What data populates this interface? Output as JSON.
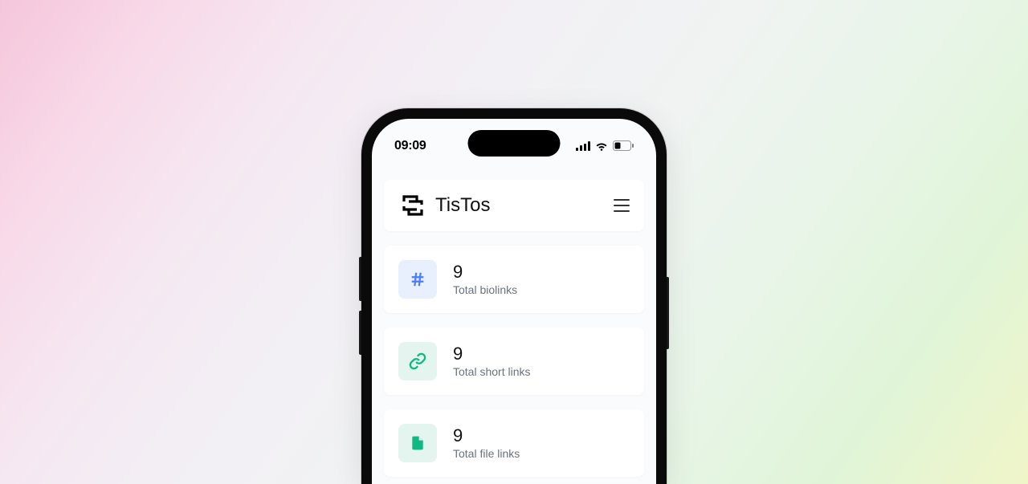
{
  "status": {
    "time": "09:09"
  },
  "header": {
    "brand": "TisTos"
  },
  "cards": [
    {
      "value": "9",
      "label": "Total biolinks"
    },
    {
      "value": "9",
      "label": "Total short links"
    },
    {
      "value": "9",
      "label": "Total file links"
    }
  ]
}
